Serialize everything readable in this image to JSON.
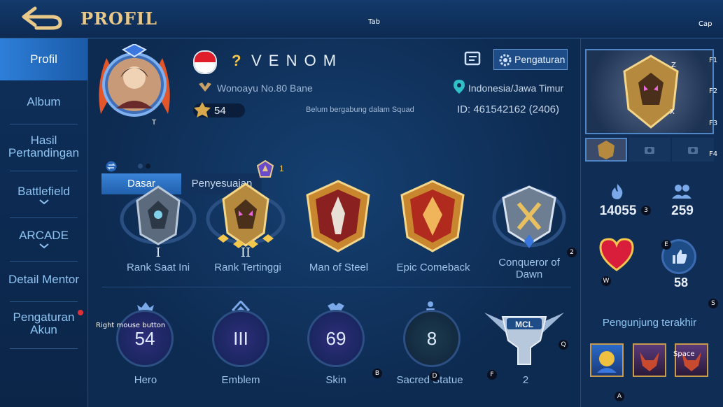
{
  "header": {
    "title": "PROFIL",
    "key_tab": "Tab",
    "key_cap": "Cap"
  },
  "sidebar": {
    "items": [
      {
        "label": "Profil"
      },
      {
        "label": "Album"
      },
      {
        "label": "Hasil Pertandingan"
      },
      {
        "label": "Battlefield"
      },
      {
        "label": "ARCADE"
      },
      {
        "label": "Detail Mentor"
      },
      {
        "label": "Pengaturan Akun"
      }
    ]
  },
  "profile": {
    "question_mark": "?",
    "name": "V E N O M",
    "guild": "Wonoayu No.80 Bane",
    "level": "54",
    "squad": "Belum bergabung dalam Squad",
    "location": "Indonesia/Jawa Timur",
    "id_label": "ID:",
    "id_value": "461542162",
    "server": "(2406)",
    "settings_label": "Pengaturan",
    "avatar_key": "T"
  },
  "tabs": [
    {
      "label": "Dasar"
    },
    {
      "label": "Penyesuaian"
    }
  ],
  "badges": {
    "top_count": "1",
    "items": [
      {
        "label": "Rank Saat Ini",
        "numeral": "I"
      },
      {
        "label": "Rank Tertinggi",
        "numeral": "II"
      },
      {
        "label": "Man of Steel"
      },
      {
        "label": "Epic Comeback"
      },
      {
        "label": "Conqueror of Dawn"
      }
    ]
  },
  "stats": [
    {
      "label": "Hero",
      "value": "54"
    },
    {
      "label": "Emblem",
      "value": "III"
    },
    {
      "label": "Skin",
      "value": "69"
    },
    {
      "label": "Sacred Statue",
      "value": "8"
    },
    {
      "label": "",
      "value": "2",
      "logo_text": "MCL"
    }
  ],
  "overlay_keys": {
    "right_mouse": "Right mouse button",
    "b": "B",
    "d": "D",
    "f": "F",
    "q": "Q",
    "two": "2",
    "three": "3",
    "e": "E",
    "w": "W",
    "s": "S",
    "a": "A",
    "z": "Z",
    "x": "X",
    "f1": "F1",
    "f2": "F2",
    "f3": "F3",
    "f4": "F4",
    "space": "Space"
  },
  "right_panel": {
    "popularity": "14055",
    "friends": "259",
    "likes": "58",
    "recent_visitors": "Pengunjung terakhir"
  },
  "colors": {
    "accent": "#2d7fd8",
    "gold": "#e8c98a",
    "notify": "#e0303a"
  }
}
